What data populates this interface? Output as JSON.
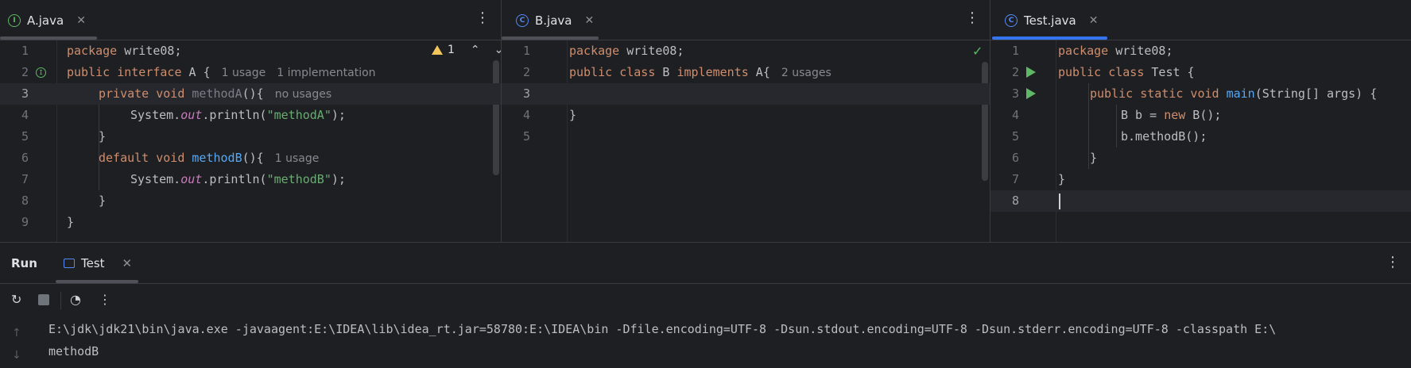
{
  "editors": {
    "a": {
      "tab": "A.java",
      "icon": "interface-icon",
      "hints": {
        "interface": [
          "1 usage",
          "1 implementation"
        ],
        "methodA": "no usages",
        "methodB": "1 usage"
      },
      "warning_count": "1",
      "line_numbers": [
        "1",
        "2",
        "3",
        "4",
        "5",
        "6",
        "7",
        "8",
        "9"
      ],
      "code": {
        "l1_kw": "package",
        "l1_rest": " write08;",
        "l2_kw": "public interface",
        "l2_rest": " A {",
        "l3_kw": "private void",
        "l3_name": "methodA",
        "l3_rest": "(){",
        "l4_pre": "System.",
        "l4_out": "out",
        "l4_mid": ".println(",
        "l4_str": "\"methodA\"",
        "l4_end": ");",
        "l5": "}",
        "l6_kw": "default void",
        "l6_name": "methodB",
        "l6_rest": "(){",
        "l7_pre": "System.",
        "l7_out": "out",
        "l7_mid": ".println(",
        "l7_str": "\"methodB\"",
        "l7_end": ");",
        "l8": "}",
        "l9": "}"
      }
    },
    "b": {
      "tab": "B.java",
      "icon": "class-icon",
      "hints": {
        "class": "2 usages"
      },
      "line_numbers": [
        "1",
        "2",
        "3",
        "4",
        "5"
      ],
      "code": {
        "l1_kw": "package",
        "l1_rest": " write08;",
        "l2_kw": "public class",
        "l2_mid": " B ",
        "l2_kw2": "implements",
        "l2_rest": " A{",
        "l4": "}"
      }
    },
    "test": {
      "tab": "Test.java",
      "icon": "runnable-class-icon",
      "line_numbers": [
        "1",
        "2",
        "3",
        "4",
        "5",
        "6",
        "7",
        "8"
      ],
      "code": {
        "l1_kw": "package",
        "l1_rest": " write08;",
        "l2_kw": "public class",
        "l2_rest": " Test {",
        "l3_kw": "public static void",
        "l3_name": "main",
        "l3_rest": "(String[] args) {",
        "l4_pre": "B b = ",
        "l4_kw": "new",
        "l4_rest": " B();",
        "l5": "b.methodB();",
        "l6": "}",
        "l7": "}"
      }
    }
  },
  "run_panel": {
    "title": "Run",
    "tab": "Test",
    "console": [
      "E:\\jdk\\jdk21\\bin\\java.exe -javaagent:E:\\IDEA\\lib\\idea_rt.jar=58780:E:\\IDEA\\bin -Dfile.encoding=UTF-8 -Dsun.stdout.encoding=UTF-8 -Dsun.stderr.encoding=UTF-8 -classpath E:\\",
      "methodB"
    ]
  },
  "colors": {
    "accent": "#3574f0",
    "keyword": "#cf8e6d",
    "string": "#6aab73",
    "method": "#56a8f5",
    "static_field": "#c77dbb"
  }
}
